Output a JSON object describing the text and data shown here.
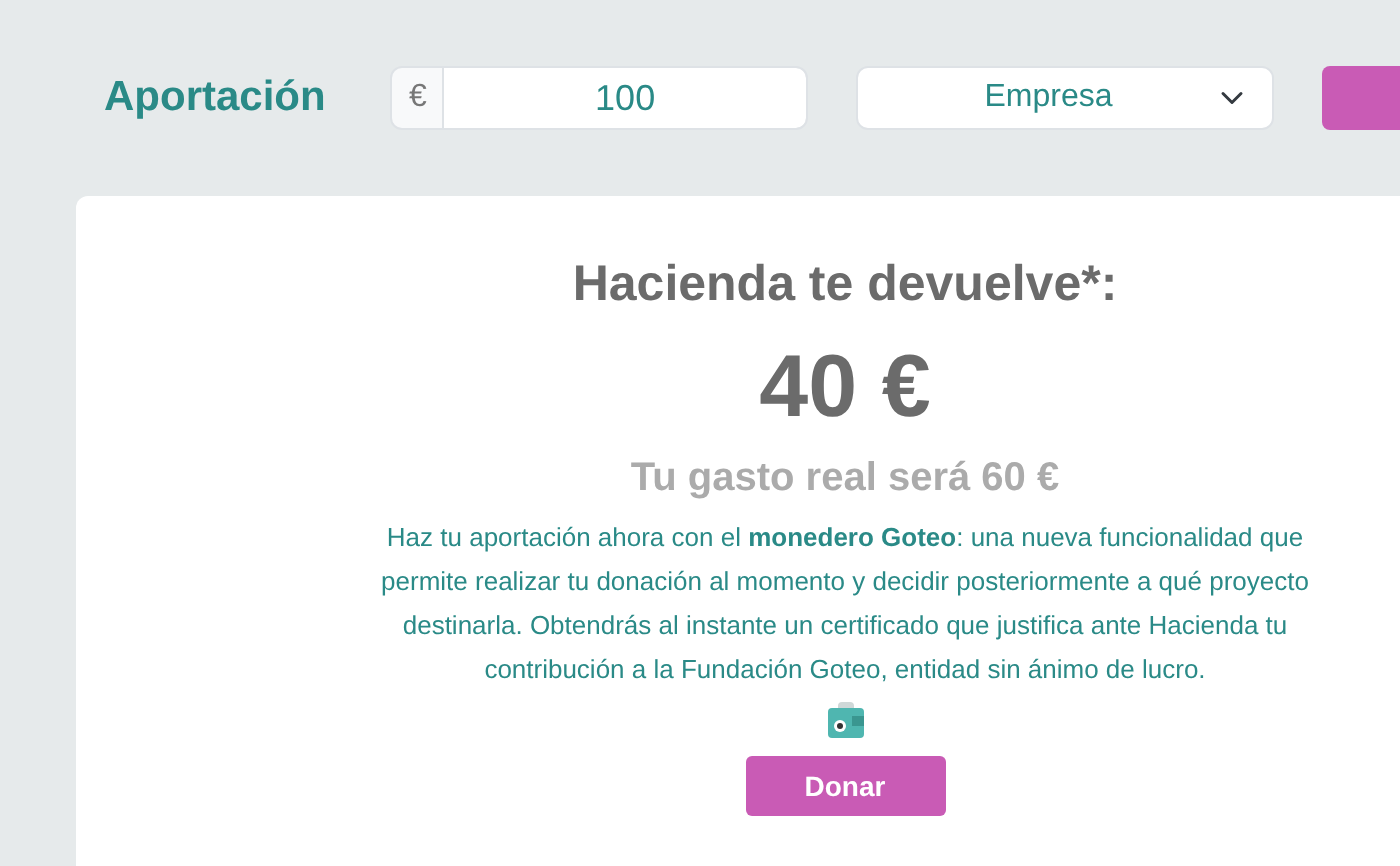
{
  "contribution": {
    "label": "Aportación",
    "currency": "€",
    "amount": "100",
    "type": "Empresa"
  },
  "refund": {
    "title": "Hacienda te devuelve*:",
    "amount": "40 €",
    "real_cost": "Tu gasto real será 60 €",
    "description": "Haz tu aportación ahora con el **monedero Goteo**: una nueva funcionalidad que permite realizar tu donación al momento y decidir posteriormente a qué proyecto destinarla. Obtendrás al instante un certificado que justifica ante Hacienda tu contribución a la Fundación Goteo, entidad sin ánimo de lucro.",
    "button": "Donar"
  }
}
